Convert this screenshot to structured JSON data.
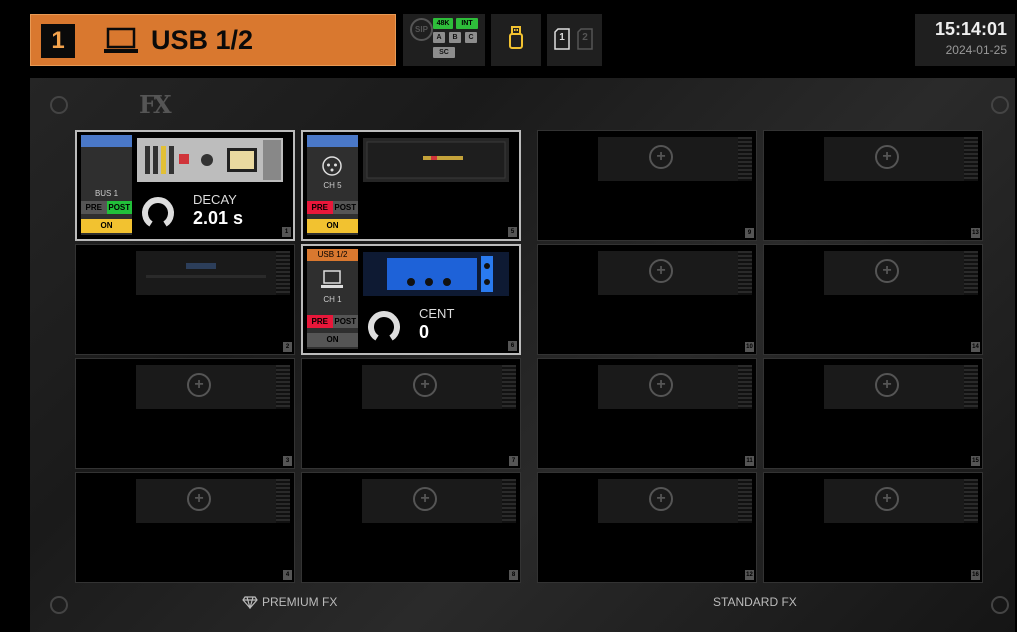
{
  "header": {
    "channel_number": "1",
    "channel_name": "USB 1/2",
    "status": {
      "sip": "SIP",
      "rate": "48K",
      "clock": "INT",
      "buttons": [
        "A",
        "B",
        "C"
      ],
      "sc": "SC"
    },
    "memory": {
      "slot1": "1",
      "slot2": "2"
    },
    "clock": {
      "time": "15:14:01",
      "date": "2024-01-25"
    }
  },
  "fx_logo": "FX",
  "slots": {
    "s1": {
      "number": "1",
      "source": "BUS 1",
      "pre": "PRE",
      "post": "POST",
      "on": "ON",
      "param_name": "DECAY",
      "param_value": "2.01 s"
    },
    "s2": {
      "number": "2"
    },
    "s3": {
      "number": "3"
    },
    "s4": {
      "number": "4"
    },
    "s5": {
      "number": "5",
      "source": "CH 5",
      "pre": "PRE",
      "post": "POST",
      "on": "ON"
    },
    "s6": {
      "number": "6",
      "source_tag": "USB 1/2",
      "source": "CH 1",
      "pre": "PRE",
      "post": "POST",
      "on": "ON",
      "param_name": "CENT",
      "param_value": "0"
    },
    "s7": {
      "number": "7"
    },
    "s8": {
      "number": "8"
    },
    "s9": {
      "number": "9"
    },
    "s10": {
      "number": "10"
    },
    "s11": {
      "number": "11"
    },
    "s12": {
      "number": "12"
    },
    "s13": {
      "number": "13"
    },
    "s14": {
      "number": "14"
    },
    "s15": {
      "number": "15"
    },
    "s16": {
      "number": "16"
    }
  },
  "footer": {
    "premium": "PREMIUM FX",
    "standard": "STANDARD FX"
  },
  "colors": {
    "accent": "#d9782f",
    "on_yellow": "#f2c230",
    "pre_red": "#e8173a",
    "post_green": "#22c03a",
    "bus_blue": "#4a78c8"
  }
}
